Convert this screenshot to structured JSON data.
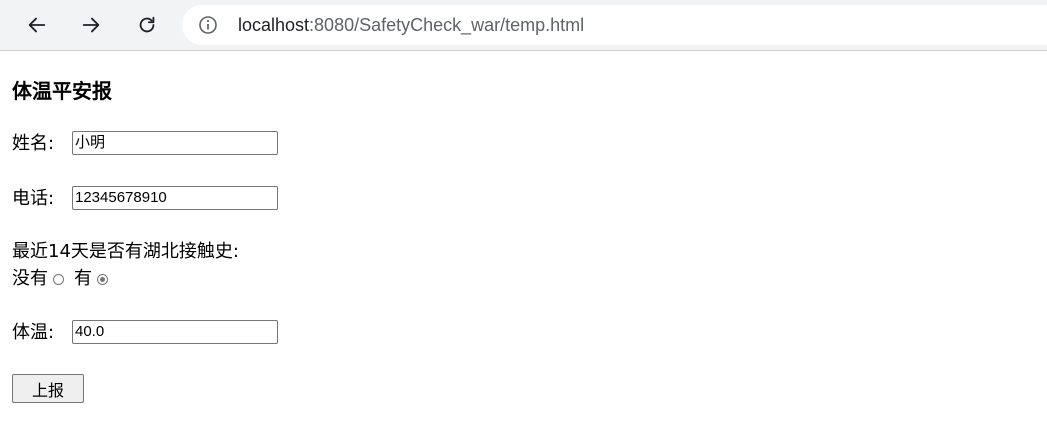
{
  "browser": {
    "url_host": "localhost",
    "url_rest": ":8080/SafetyCheck_war/temp.html",
    "icons": {
      "back": "arrow-left-icon",
      "forward": "arrow-right-icon",
      "reload": "reload-icon",
      "site_info": "info-icon"
    }
  },
  "form": {
    "title": "体温平安报",
    "name_label": "姓名:",
    "name_value": "小明",
    "phone_label": "电话:",
    "phone_value": "12345678910",
    "question": "最近14天是否有湖北接触史:",
    "option_no": "没有",
    "option_yes": "有",
    "selected": "有",
    "temp_label": "体温:",
    "temp_value": "40.0",
    "submit_label": "上报"
  }
}
